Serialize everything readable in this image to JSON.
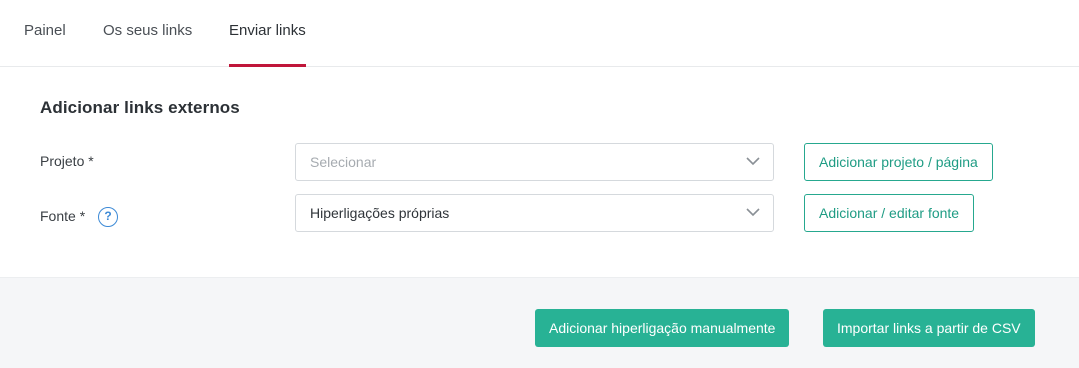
{
  "tabs": [
    {
      "label": "Painel"
    },
    {
      "label": "Os seus links"
    },
    {
      "label": "Enviar links",
      "active": true
    }
  ],
  "form": {
    "title": "Adicionar links externos",
    "project": {
      "label": "Projeto *",
      "placeholder": "Selecionar",
      "add_button": "Adicionar projeto / página"
    },
    "source": {
      "label": "Fonte *",
      "help_icon": "?",
      "value": "Hiperligações próprias",
      "edit_button": "Adicionar / editar fonte"
    }
  },
  "footer": {
    "manual_button": "Adicionar hiperligação manualmente",
    "csv_button": "Importar links a partir de CSV"
  },
  "colors": {
    "accent_tab": "#c0163a",
    "primary": "#28b295",
    "help": "#3d8ad6"
  }
}
